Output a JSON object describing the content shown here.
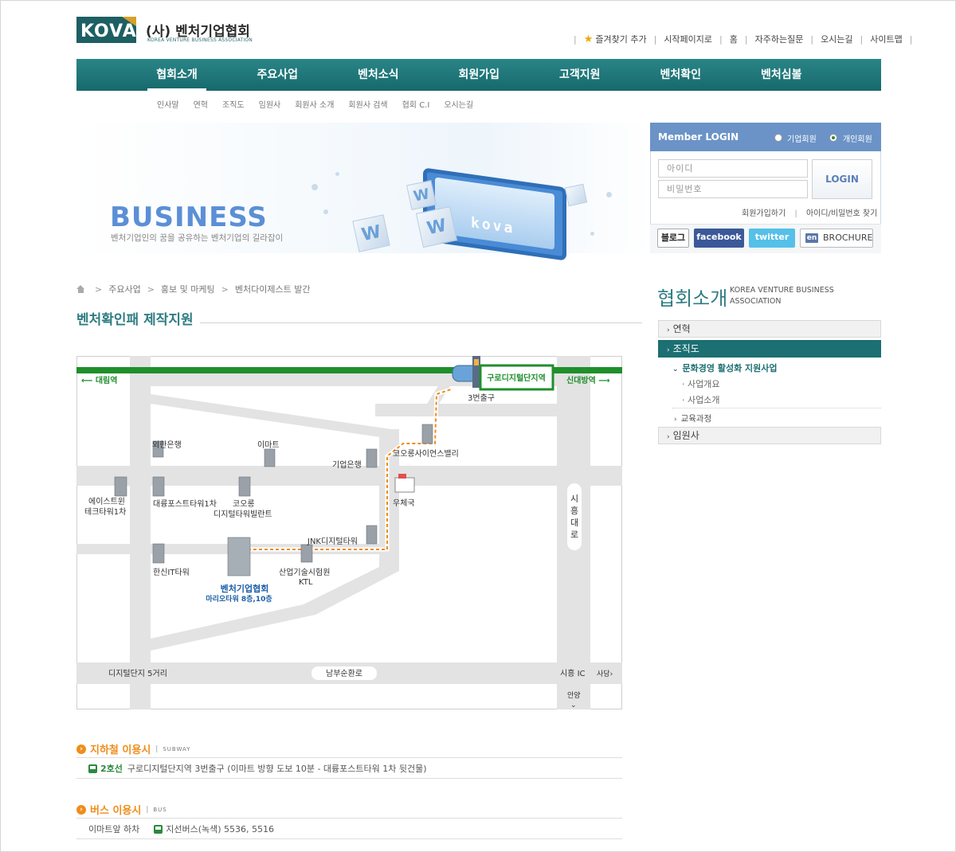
{
  "header": {
    "logo_text": "KOVA",
    "org_name": "(사) 벤처기업협회",
    "org_eng": "KOREA VENTURE BUSINESS ASSOCIATION",
    "top_links": [
      "즐겨찾기 추가",
      "시작페이지로",
      "홈",
      "자주하는질문",
      "오시는길",
      "사이트맵"
    ]
  },
  "gnb": {
    "menus": [
      "협회소개",
      "주요사업",
      "벤처소식",
      "회원가입",
      "고객지원",
      "벤처확인",
      "벤처심볼"
    ],
    "active_index": 0,
    "submenus": [
      "인사말",
      "연혁",
      "조직도",
      "임원사",
      "회원사 소개",
      "회원사 검색",
      "협회 C.I",
      "오시는길"
    ]
  },
  "banner": {
    "title": "BUSINESS",
    "subtitle": "벤처기업인의 꿈을 공유하는 벤처기업의 길라잡이",
    "screen_text": "kova"
  },
  "login": {
    "title": "Member LOGIN",
    "radio_corporate": "기업회원",
    "radio_personal": "개인회원",
    "selected": "개인회원",
    "id_placeholder": "아이디",
    "pw_placeholder": "비밀번호",
    "login_button": "LOGIN",
    "join_link": "회원가입하기",
    "find_link": "아이디/비밀번호 찾기",
    "sns": {
      "blog": "블로그",
      "facebook": "facebook",
      "twitter": "twitter",
      "brochure_badge": "en",
      "brochure": "BROCHURE"
    }
  },
  "breadcrumb": [
    "주요사업",
    "홍보 및 마케팅",
    "벤처다이제스트 발간"
  ],
  "page_title": "벤처확인패 제작지원",
  "map": {
    "station": "구로디지털단지역",
    "exit": "3번출구",
    "west_station": "대림역",
    "east_station": "신대방역",
    "labels": {
      "woori": "외한은행",
      "emart": "이마트",
      "ibk": "기업은행",
      "kolon_science": "코오롱사이언스밸리",
      "post": "우체국",
      "east_tower_1": "에이스트윈",
      "east_tower_2": "테크타워1차",
      "daeryung": "대륭포스트타워1차",
      "kolon_1": "코오롱",
      "kolon_2": "디지털타워빌란트",
      "jnk": "JNK디지털타워",
      "hanshin": "한신IT타워",
      "ktl_1": "산업기술시험원",
      "ktl_2": "KTL",
      "kova_1": "벤처기업협회",
      "kova_2": "마리오타워 8층,10층",
      "siheung_road": "시흥대로",
      "digital_5": "디지털단지 5거리",
      "nambu": "남부순환로",
      "siheung_ic": "시흥 IC",
      "sadang": "사당",
      "anyang": "안양"
    }
  },
  "subway": {
    "title": "지하철 이용시",
    "eng": "SUBWAY",
    "line": "2호선",
    "desc": "구로디지털단지역 3번출구 (이마트 방향 도보 10분 - 대륭포스트타워 1차 뒷건물)"
  },
  "bus": {
    "title": "버스 이용시",
    "eng": "BUS",
    "stop": "이마트앞 하차",
    "desc": "지선버스(녹색) 5536, 5516"
  },
  "side": {
    "title": "협회소개",
    "eng": "KOREA VENTURE BUSINESS ASSOCIATION",
    "items": [
      "연혁",
      "조직도",
      "임원사"
    ],
    "sub1": "문화경영 활성화 지원사업",
    "sub2": [
      "사업개요",
      "사업소개"
    ],
    "sub3": "교육과정"
  },
  "colors": {
    "teal": "#1c6f72",
    "orange": "#ef8d1c",
    "green_line": "#1f8f2b",
    "login_blue": "#6b93c7"
  }
}
